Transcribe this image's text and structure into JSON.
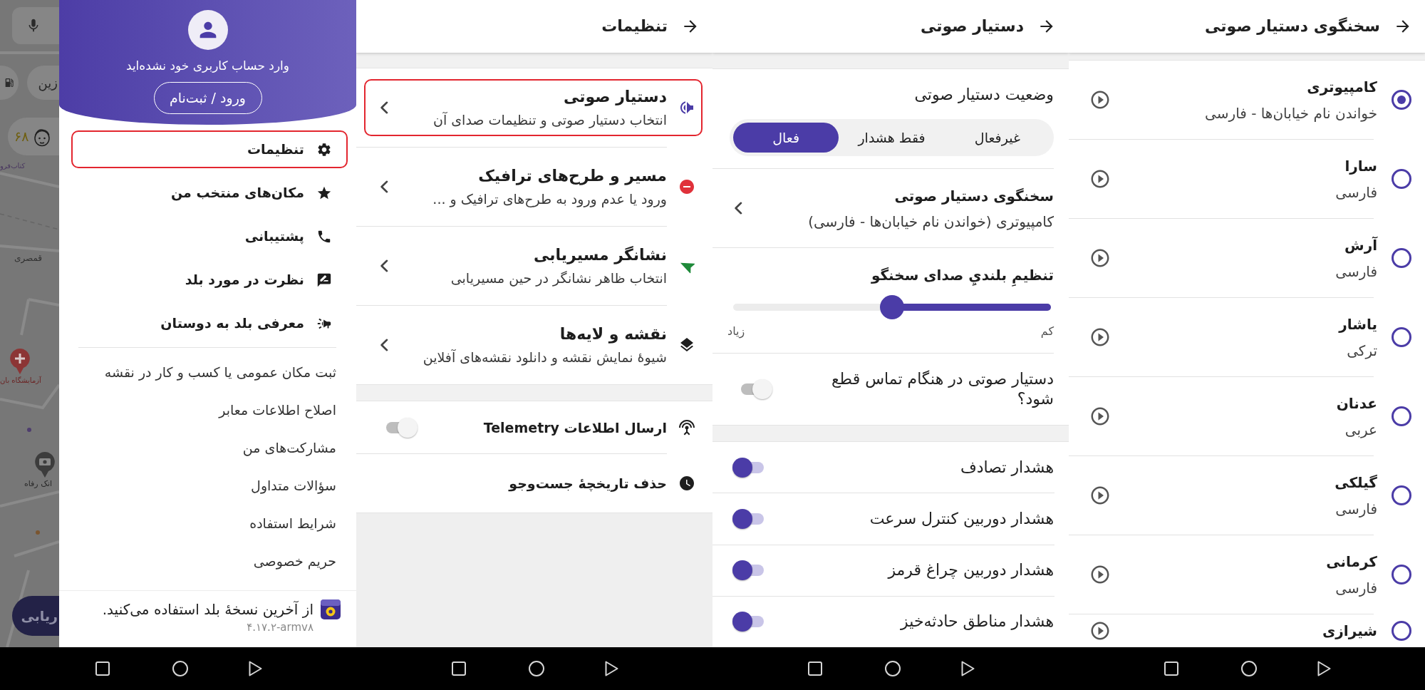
{
  "drawer_screen": {
    "map": {
      "chips": [
        "زین",
        "۶۸"
      ],
      "labels": [
        "کتاب‌فرو",
        "قمصری",
        "آزمایشگاه بان",
        "انک رفاه"
      ],
      "route_button": "ریابی"
    },
    "drawer": {
      "account_status": "وارد حساب کاربری خود نشده‌اید",
      "login_button": "ورود / ثبت‌نام",
      "main_items": [
        {
          "label": "تنظیمات",
          "highlighted": true
        },
        {
          "label": "مکان‌های منتخب من",
          "highlighted": false
        },
        {
          "label": "پشتیبانی",
          "highlighted": false
        },
        {
          "label": "نظرت در مورد بلد",
          "highlighted": false
        },
        {
          "label": "معرفی بلد به دوستان",
          "highlighted": false
        }
      ],
      "links": [
        "ثبت مکان عمومی یا کسب و کار در نقشه",
        "اصلاح اطلاعات معابر",
        "مشارکت‌های من",
        "سؤالات متداول",
        "شرایط استفاده",
        "حریم خصوصی"
      ],
      "footer": {
        "message": "از آخرین نسخهٔ بلد استفاده می‌کنید.",
        "version": "۴.۱۷.۲-armv۸"
      }
    }
  },
  "settings_screen": {
    "title": "تنظیمات",
    "items": [
      {
        "title": "دستیار صوتی",
        "subtitle": "انتخاب دستیار صوتی و تنظیمات صدای آن",
        "highlighted": true
      },
      {
        "title": "مسیر و طرح‌های ترافیک",
        "subtitle": "ورود یا عدم ورود به طرح‌های ترافیک و ...",
        "highlighted": false
      },
      {
        "title": "نشانگر مسیریابی",
        "subtitle": "انتخاب ظاهر نشانگر در حین مسیریابی",
        "highlighted": false
      },
      {
        "title": "نقشه و لایه‌ها",
        "subtitle": "شیوهٔ نمایش نقشه و دانلود نقشه‌های آفلاین",
        "highlighted": false
      }
    ],
    "extra_items": [
      {
        "kind": "switch",
        "label": "ارسال اطلاعات Telemetry",
        "on": false
      },
      {
        "kind": "action",
        "label": "حذف تاریخچهٔ جست‌وجو"
      }
    ]
  },
  "voice_assistant_screen": {
    "title": "دستیار صوتی",
    "status": {
      "label": "وضعیت دستیار صوتی",
      "options": [
        {
          "label": "غیرفعال",
          "selected": false
        },
        {
          "label": "فقط هشدار",
          "selected": false
        },
        {
          "label": "فعال",
          "selected": true
        }
      ]
    },
    "speaker": {
      "title": "سخنگوی دستیار صوتی",
      "value": "کامپیوتری (خواندن نام خیابان‌ها - فارسی)"
    },
    "volume": {
      "label": "تنظیمِ بلنديِ صدای سخنگو",
      "level": 0.5,
      "min_label": "کم",
      "max_label": "زیاد"
    },
    "mute_on_call": {
      "label": "دستیار صوتی در هنگام تماس قطع شود؟",
      "on": false
    },
    "alerts": [
      {
        "label": "هشدار تصادف",
        "on": true
      },
      {
        "label": "هشدار دوربین کنترل سرعت",
        "on": true
      },
      {
        "label": "هشدار دوربین چراغ قرمز",
        "on": true
      },
      {
        "label": "هشدار مناطق حادثه‌خیز",
        "on": true
      }
    ]
  },
  "speaker_screen": {
    "title": "سخنگوی دستیار صوتی",
    "voices": [
      {
        "name": "کامپیوتری",
        "language": "خواندن نام خیابان‌ها - فارسی",
        "selected": true
      },
      {
        "name": "سارا",
        "language": "فارسی",
        "selected": false
      },
      {
        "name": "آرش",
        "language": "فارسی",
        "selected": false
      },
      {
        "name": "یاشار",
        "language": "ترکی",
        "selected": false
      },
      {
        "name": "عدنان",
        "language": "عربی",
        "selected": false
      },
      {
        "name": "گیلکی",
        "language": "فارسی",
        "selected": false
      },
      {
        "name": "کرمانی",
        "language": "فارسی",
        "selected": false
      },
      {
        "name": "شیرازی",
        "selected": false
      }
    ]
  }
}
